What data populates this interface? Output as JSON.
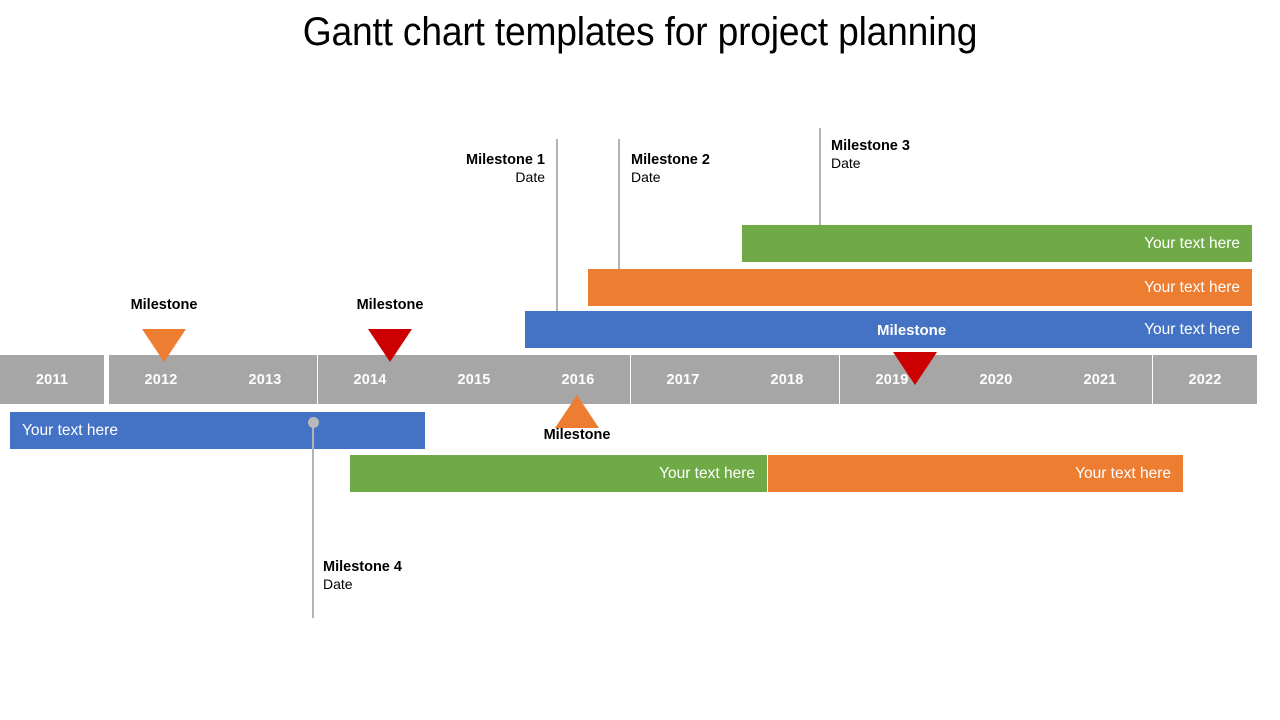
{
  "title": "Gantt chart templates for project planning",
  "colors": {
    "blue": "#4472C4",
    "orange": "#ED7D31",
    "green": "#6FAA46",
    "axis_gray": "#A6A6A6",
    "connector_gray": "#B3B3B3",
    "milestone_red": "#CC0000",
    "milestone_orange": "#ED7D31",
    "bar_text": "#FFFFFF"
  },
  "axis": {
    "years": [
      "2011",
      "2012",
      "2013",
      "2014",
      "2015",
      "2016",
      "2017",
      "2018",
      "2019",
      "2020",
      "2021",
      "2022"
    ]
  },
  "callouts": [
    {
      "name": "Milestone 1",
      "date": "Date"
    },
    {
      "name": "Milestone 2",
      "date": "Date"
    },
    {
      "name": "Milestone 3",
      "date": "Date"
    },
    {
      "name": "Milestone 4",
      "date": "Date"
    }
  ],
  "bars": [
    {
      "id": "green-top",
      "text": "Your text here",
      "color": "green"
    },
    {
      "id": "orange-top",
      "text": "Your text here",
      "color": "orange"
    },
    {
      "id": "blue-top",
      "text": "Your text here",
      "color": "blue",
      "inline_label": "Milestone"
    },
    {
      "id": "blue-bottom",
      "text": "Your text here",
      "color": "blue"
    },
    {
      "id": "green-bottom",
      "text": "Your text here",
      "color": "green"
    },
    {
      "id": "orange-bottom",
      "text": "Your text here",
      "color": "orange"
    }
  ],
  "triangle_markers": [
    {
      "id": "marker-2012",
      "label": "Milestone",
      "color": "#ED7D31",
      "direction": "down"
    },
    {
      "id": "marker-2014",
      "label": "Milestone",
      "color": "#CC0000",
      "direction": "down"
    },
    {
      "id": "marker-2019",
      "label": "",
      "color": "#CC0000",
      "direction": "down"
    },
    {
      "id": "marker-2016",
      "label": "Milestone",
      "color": "#ED7D31",
      "direction": "up"
    }
  ],
  "chart_data": {
    "type": "bar",
    "title": "Gantt chart templates for project planning",
    "xlabel": "",
    "ylabel": "",
    "categories": [
      "2011",
      "2012",
      "2013",
      "2014",
      "2015",
      "2016",
      "2017",
      "2018",
      "2019",
      "2020",
      "2021",
      "2022"
    ],
    "x_axis_years": [
      2011,
      2022
    ],
    "grid": false,
    "legend": "none",
    "tasks": [
      {
        "name": "Your text here",
        "color": "#6FAA46",
        "start_year": 2018.1,
        "end_year": 2023.0,
        "row": 1,
        "label_align": "right"
      },
      {
        "name": "Your text here",
        "color": "#ED7D31",
        "start_year": 2016.7,
        "end_year": 2023.0,
        "row": 2,
        "label_align": "right"
      },
      {
        "name": "Your text here",
        "color": "#4472C4",
        "start_year": 2016.1,
        "end_year": 2023.0,
        "row": 3,
        "label_align": "right",
        "inline_label": "Milestone"
      },
      {
        "name": "Your text here",
        "color": "#4472C4",
        "start_year": 2011.0,
        "end_year": 2015.1,
        "row": 4,
        "label_align": "left"
      },
      {
        "name": "Your text here",
        "color": "#6FAA46",
        "start_year": 2014.2,
        "end_year": 2018.2,
        "row": 5,
        "label_align": "right"
      },
      {
        "name": "Your text here",
        "color": "#ED7D31",
        "start_year": 2018.2,
        "end_year": 2022.2,
        "row": 5,
        "label_align": "right"
      }
    ],
    "milestones": [
      {
        "name": "Milestone 1",
        "date": "Date",
        "year": 2016.4,
        "target_row": 3,
        "label_align": "right"
      },
      {
        "name": "Milestone 2",
        "date": "Date",
        "year": 2017.0,
        "target_row": 2,
        "label_align": "left"
      },
      {
        "name": "Milestone 3",
        "date": "Date",
        "year": 2018.9,
        "target_row": 1,
        "label_align": "left"
      },
      {
        "name": "Milestone 4",
        "date": "Date",
        "year": 2014.0,
        "target_row": 4,
        "label_align": "left"
      }
    ],
    "axis_markers": [
      {
        "label": "Milestone",
        "year": 2012,
        "color": "#ED7D31",
        "direction": "down"
      },
      {
        "label": "Milestone",
        "year": 2014,
        "color": "#CC0000",
        "direction": "down"
      },
      {
        "label": "",
        "year": 2019,
        "color": "#CC0000",
        "direction": "down"
      },
      {
        "label": "Milestone",
        "year": 2016,
        "color": "#ED7D31",
        "direction": "up"
      }
    ]
  }
}
